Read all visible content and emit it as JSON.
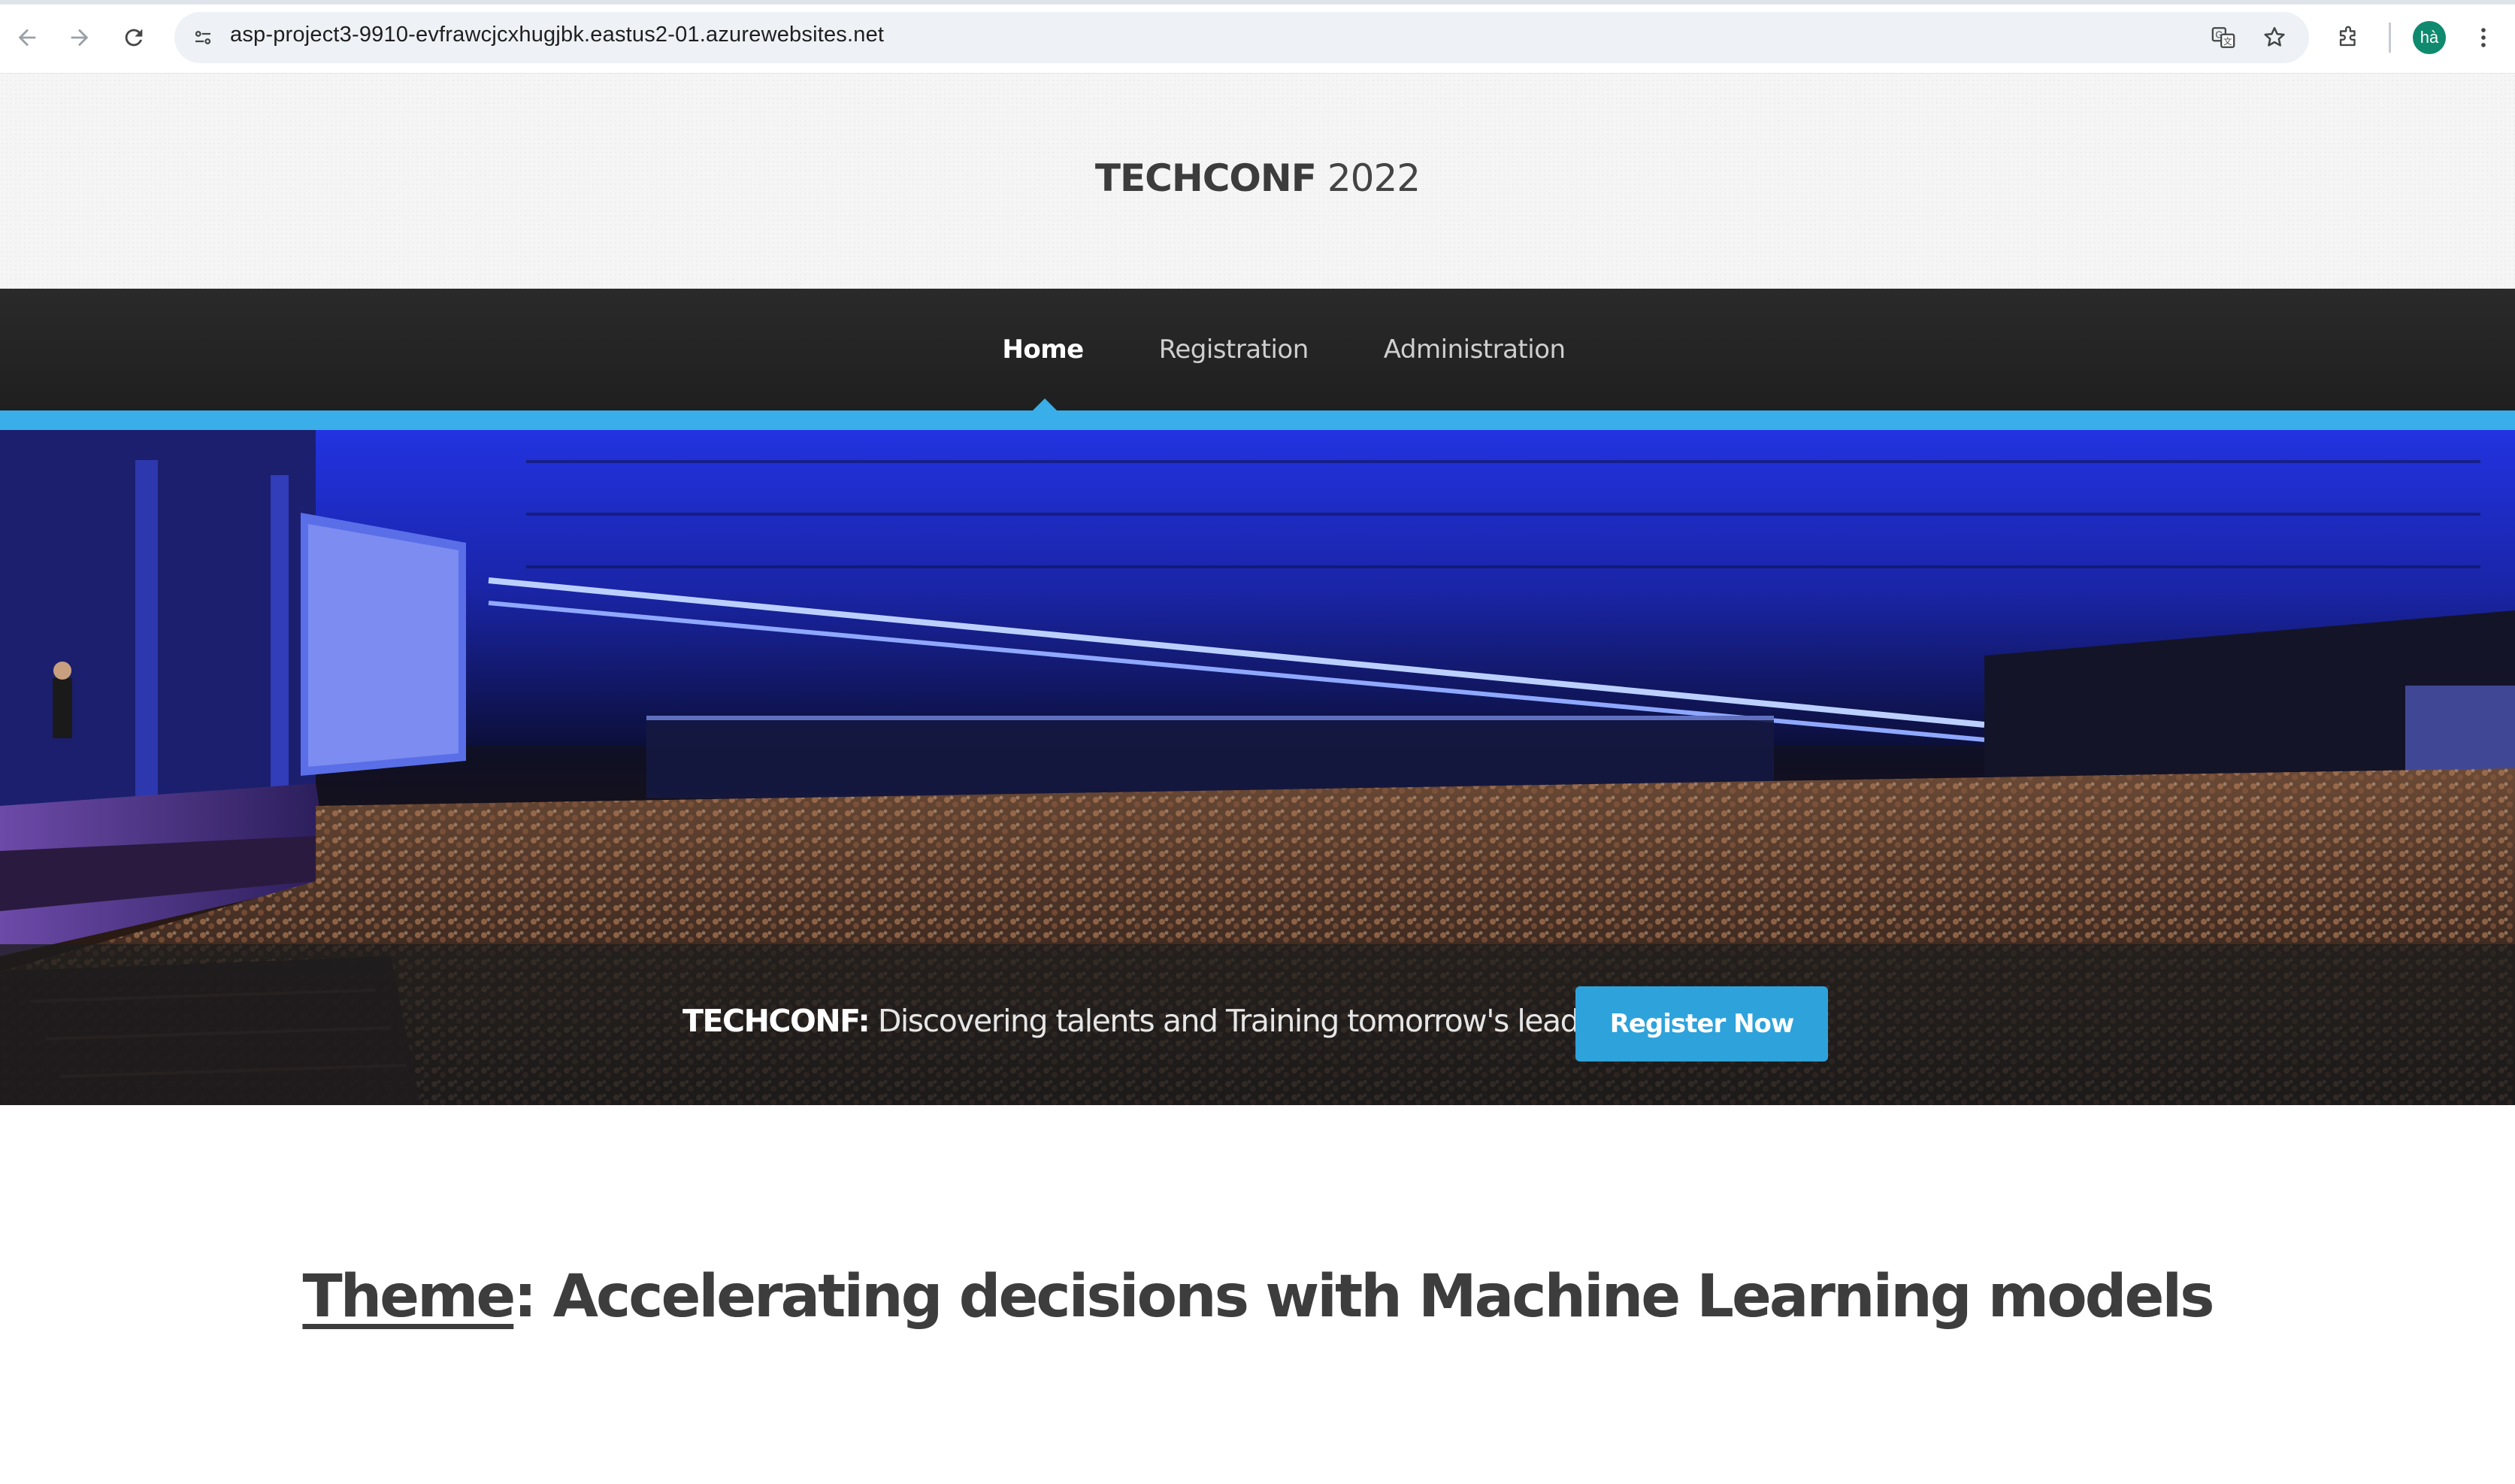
{
  "browser": {
    "url": "asp-project3-9910-evfrawcjcxhugjbk.eastus2-01.azurewebsites.net",
    "profile_initials": "hà",
    "icons": [
      "back-arrow-icon",
      "forward-arrow-icon",
      "reload-icon",
      "site-info-icon",
      "translate-icon",
      "bookmark-star-icon",
      "extensions-icon",
      "more-vert-icon"
    ]
  },
  "header": {
    "logo_strong": "TECHCONF",
    "logo_year": " 2022"
  },
  "nav": {
    "items": [
      {
        "label": "Home",
        "active": true
      },
      {
        "label": "Registration",
        "active": false
      },
      {
        "label": "Administration",
        "active": false
      }
    ],
    "accent_color": "#3aaee8"
  },
  "hero": {
    "brand": "TECHCONF:",
    "tagline": " Discovering talents and Training tomorrow's leaders",
    "cta_label": "Register Now",
    "cta_color": "#2ea2db"
  },
  "theme": {
    "link_text": "Theme",
    "text": ": Accelerating decisions with Machine Learning models"
  }
}
